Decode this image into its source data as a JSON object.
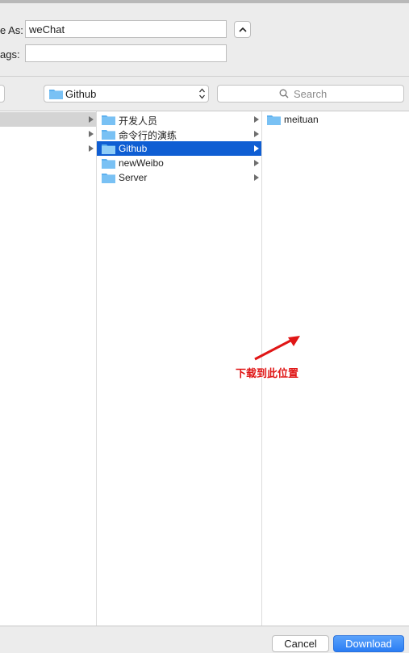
{
  "form": {
    "save_as_label": "e As:",
    "save_as_value": "weChat",
    "tags_label": "ags:",
    "tags_value": ""
  },
  "location": {
    "selected": "Github",
    "search_placeholder": "Search"
  },
  "columns": {
    "col2": [
      {
        "label": "开发人员",
        "selected": false
      },
      {
        "label": "命令行的演练",
        "selected": false
      },
      {
        "label": "Github",
        "selected": true
      },
      {
        "label": "newWeibo",
        "selected": false
      },
      {
        "label": "Server",
        "selected": false
      }
    ],
    "col3": [
      {
        "label": "meituan"
      }
    ]
  },
  "annotation": {
    "text": "下载到此位置",
    "color": "#e01616"
  },
  "buttons": {
    "cancel": "Cancel",
    "download": "Download"
  },
  "colors": {
    "selection": "#0f5ed3",
    "folder": "#5eb1ef",
    "primary": "#2a7df4"
  },
  "icons": [
    "folder-icon",
    "chevron-up-icon",
    "up-down-arrows-icon",
    "search-icon",
    "disclosure-triangle-icon"
  ]
}
